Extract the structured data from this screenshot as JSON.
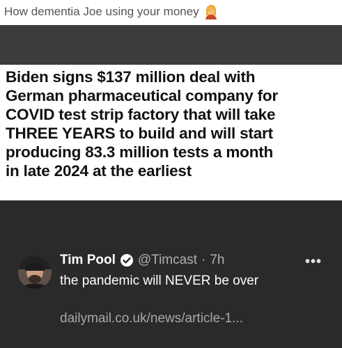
{
  "caption": {
    "text": "How dementia Joe using your money",
    "emoji": "woman-facepalming-emoji"
  },
  "headline": {
    "lines": [
      "Biden signs $137 million deal with",
      "German pharmaceutical company for",
      "COVID test strip factory that will take",
      "THREE YEARS to build and will start",
      "producing 83.3 million tests a month",
      "in late 2024 at the earliest"
    ]
  },
  "tweet": {
    "author_name": "Tim Pool",
    "handle": "@Timcast",
    "separator": "·",
    "time": "7h",
    "text": "the pandemic will NEVER be over",
    "link": "dailymail.co.uk/news/article-1...",
    "more_label": "•••",
    "verified_icon": "verified-badge-icon"
  },
  "colors": {
    "dark_band": "#3c3c3c",
    "tweet_bg": "#2a2a2a",
    "headline_text": "#111111",
    "muted_text": "#b0b0b0"
  }
}
